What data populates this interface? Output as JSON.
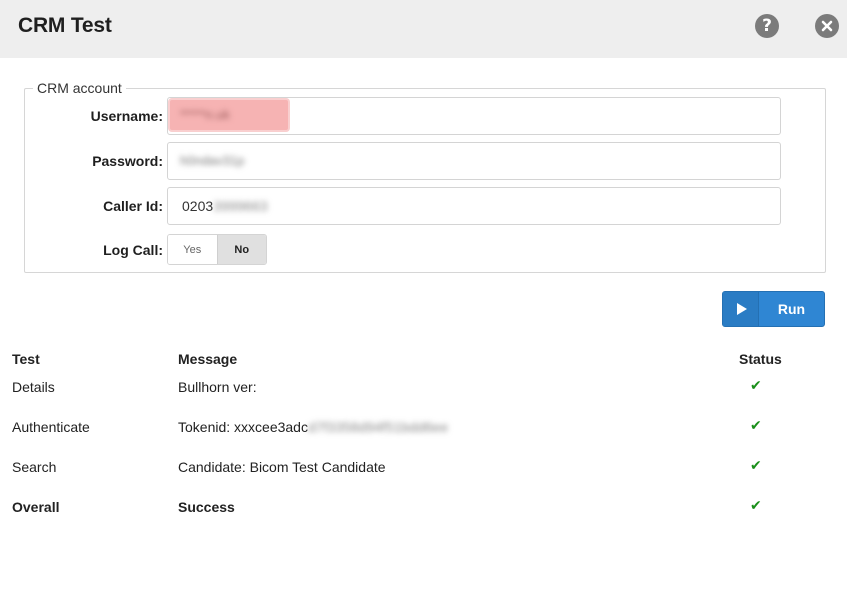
{
  "window": {
    "title": "CRM Test"
  },
  "crm_account": {
    "legend": "CRM account",
    "username": {
      "label": "Username:",
      "value": "*****n.uk"
    },
    "password": {
      "label": "Password:",
      "value": "h0ndav31p"
    },
    "caller_id": {
      "label": "Caller Id:",
      "value": "0203",
      "value_hidden": "3999663"
    },
    "log_call": {
      "label": "Log Call:",
      "yes_label": "Yes",
      "no_label": "No",
      "selected": "No"
    }
  },
  "run_button": {
    "label": "Run"
  },
  "results": {
    "headers": {
      "test": "Test",
      "message": "Message",
      "status": "Status"
    },
    "rows": [
      {
        "test": "Details",
        "message": "Bullhorn ver:",
        "message_hidden": "",
        "status": "✔"
      },
      {
        "test": "Authenticate",
        "message": "Tokenid: xxxcee3adc",
        "message_hidden": "d7f3358d94f51bdd6ee",
        "status": "✔"
      },
      {
        "test": "Search",
        "message": "Candidate: Bicom Test Candidate",
        "message_hidden": "",
        "status": "✔"
      },
      {
        "test": "Overall",
        "message": "Success",
        "message_hidden": "",
        "status": "✔"
      }
    ]
  },
  "colors": {
    "accent": "#2f86d3",
    "success": "#1a8f1a",
    "titlebar": "#eeeeee"
  }
}
